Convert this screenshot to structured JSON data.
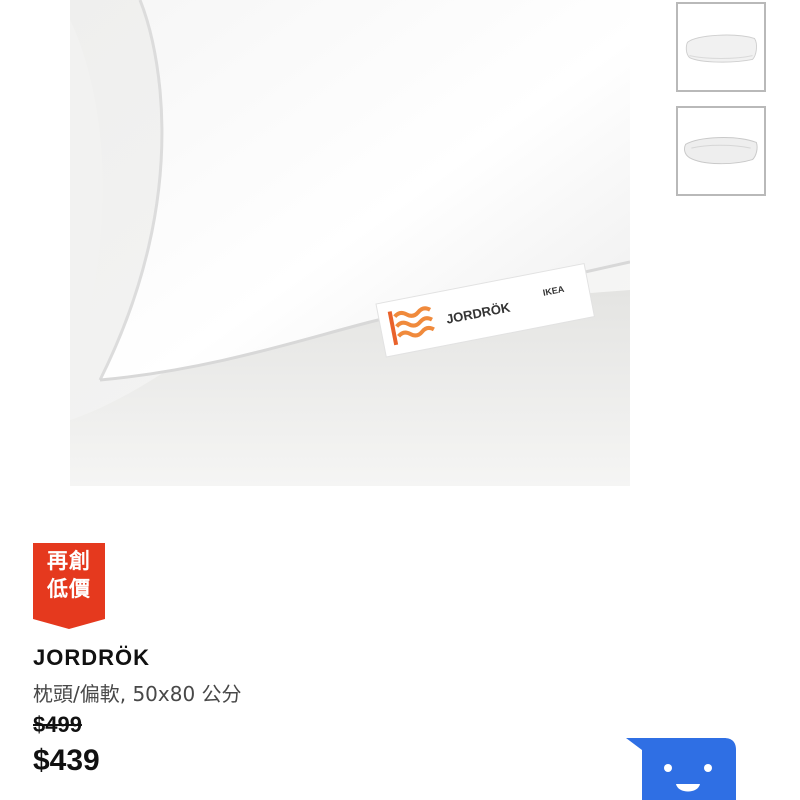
{
  "gallery": {
    "main_image_alt": "JORDRÖK pillow",
    "tag_brand_text": "JORDRÖK",
    "tag_logo_text": "IKEA",
    "thumbnails": [
      "pillow-thumbnail-1",
      "pillow-thumbnail-2"
    ]
  },
  "badge": {
    "line1": "再創",
    "line2": "低價",
    "color": "#e5391e"
  },
  "product": {
    "name": "JORDRÖK",
    "description": "枕頭/偏軟, 50x80 公分",
    "old_price": "$499",
    "price": "$439"
  },
  "chat": {
    "icon": "chat-bot-icon",
    "color": "#2f6fe4"
  }
}
